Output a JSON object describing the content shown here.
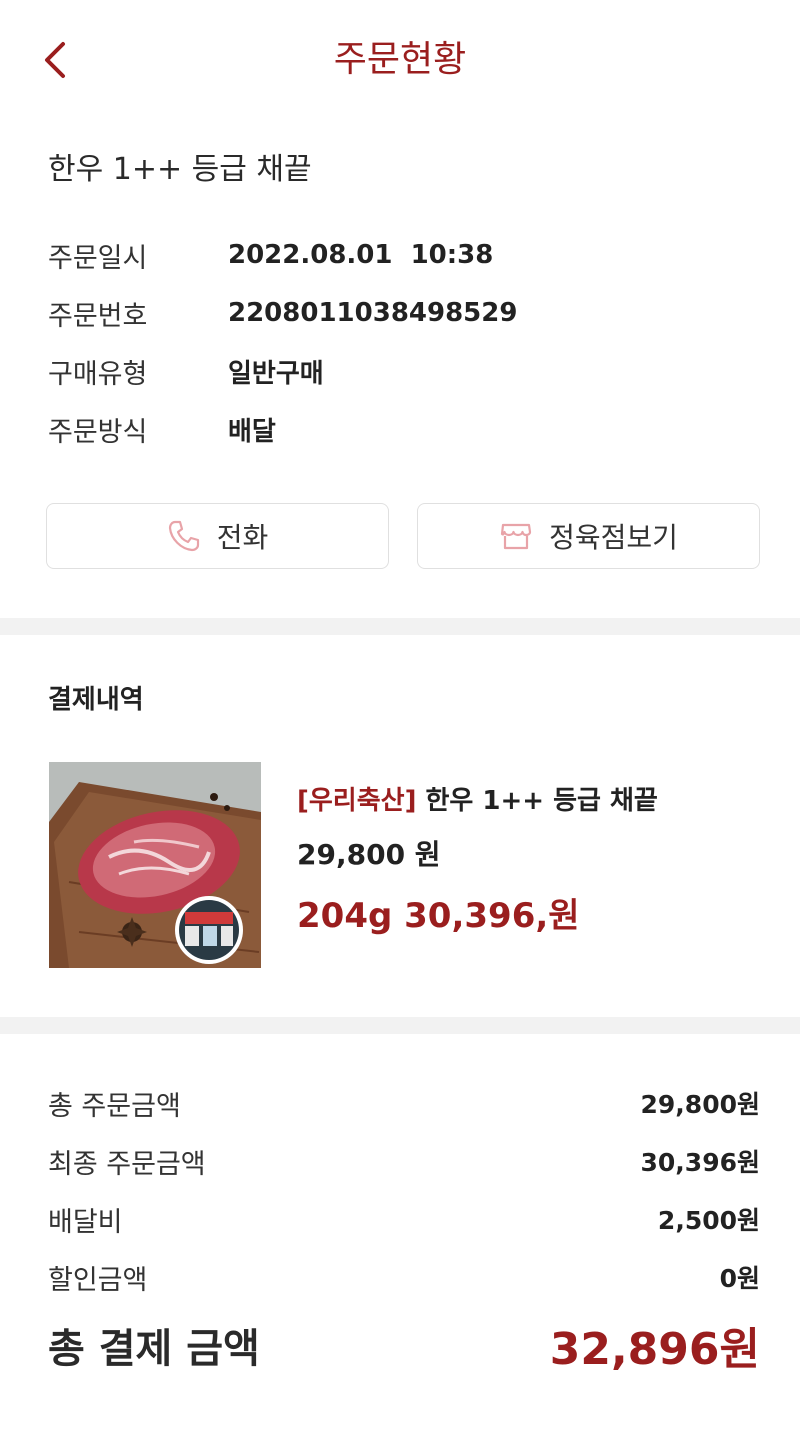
{
  "header": {
    "title": "주문현황",
    "back_icon": "chevron-left-icon",
    "accent_color": "#9a1e1e"
  },
  "order": {
    "product_name": "한우 1++ 등급 채끝",
    "info": [
      {
        "label": "주문일시",
        "value": "2022.08.01  10:38"
      },
      {
        "label": "주문번호",
        "value": "2208011038498529"
      },
      {
        "label": "구매유형",
        "value": "일반구매"
      },
      {
        "label": "주문방식",
        "value": "배달"
      }
    ]
  },
  "actions": {
    "call_label": "전화",
    "call_icon": "phone-icon",
    "store_label": "정육점보기",
    "store_icon": "store-icon"
  },
  "payment": {
    "section_title": "결제내역",
    "item": {
      "brand": "[우리축산]",
      "name": "한우 1++ 등급 채끝",
      "unit_price": "29,800 원",
      "total": "204g 30,396,원"
    },
    "summary": [
      {
        "label": "총 주문금액",
        "value": "29,800원"
      },
      {
        "label": "최종 주문금액",
        "value": "30,396원"
      },
      {
        "label": "배달비",
        "value": "2,500원"
      },
      {
        "label": "할인금액",
        "value": "0원"
      }
    ],
    "total_label": "총 결제 금액",
    "total_value": "32,896원"
  }
}
